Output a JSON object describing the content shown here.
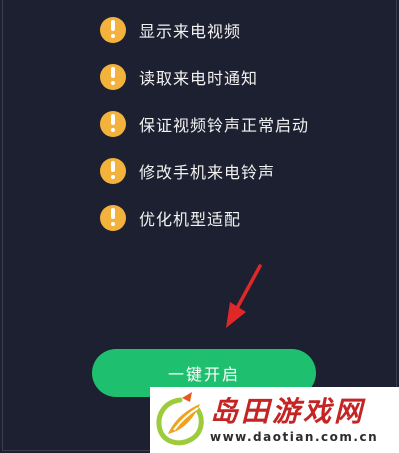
{
  "permissions": {
    "items": [
      {
        "label": "显示来电视频",
        "icon": "warning-icon"
      },
      {
        "label": "读取来电时通知",
        "icon": "warning-icon"
      },
      {
        "label": "保证视频铃声正常启动",
        "icon": "warning-icon"
      },
      {
        "label": "修改手机来电铃声",
        "icon": "warning-icon"
      },
      {
        "label": "优化机型适配",
        "icon": "warning-icon"
      }
    ]
  },
  "action": {
    "button_label": "一键开启"
  },
  "watermark": {
    "name": "岛田游戏网",
    "url": "www.daotian.com.cn"
  },
  "colors": {
    "background": "#1d2030",
    "warning": "#f3b23b",
    "button": "#1ebf6e",
    "arrow": "#e02828",
    "watermark_text": "#c52424"
  }
}
